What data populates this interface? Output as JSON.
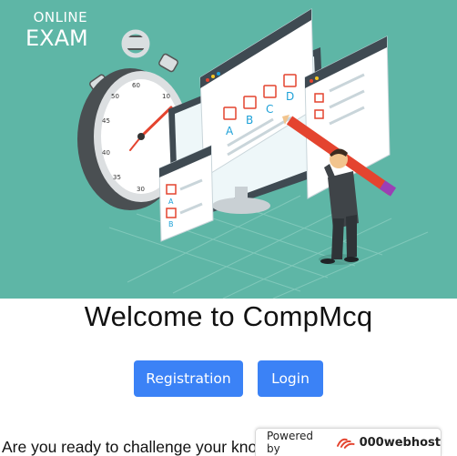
{
  "hero": {
    "brand_top": "ONLINE",
    "brand_bottom": "EXAM",
    "answer_labels": [
      "A",
      "B",
      "C",
      "D"
    ],
    "side_labels": [
      "A",
      "B"
    ]
  },
  "main": {
    "title": "Welcome to CompMcq",
    "registration_label": "Registration",
    "login_label": "Login",
    "tagline": "Are you ready to challenge your knowledge?"
  },
  "badge": {
    "powered_label": "Powered by",
    "brand": "000webhost"
  },
  "colors": {
    "hero_bg": "#5eb6a6",
    "button": "#3b82f6",
    "accent_red": "#e4442f",
    "answer_blue": "#1da1d8"
  }
}
